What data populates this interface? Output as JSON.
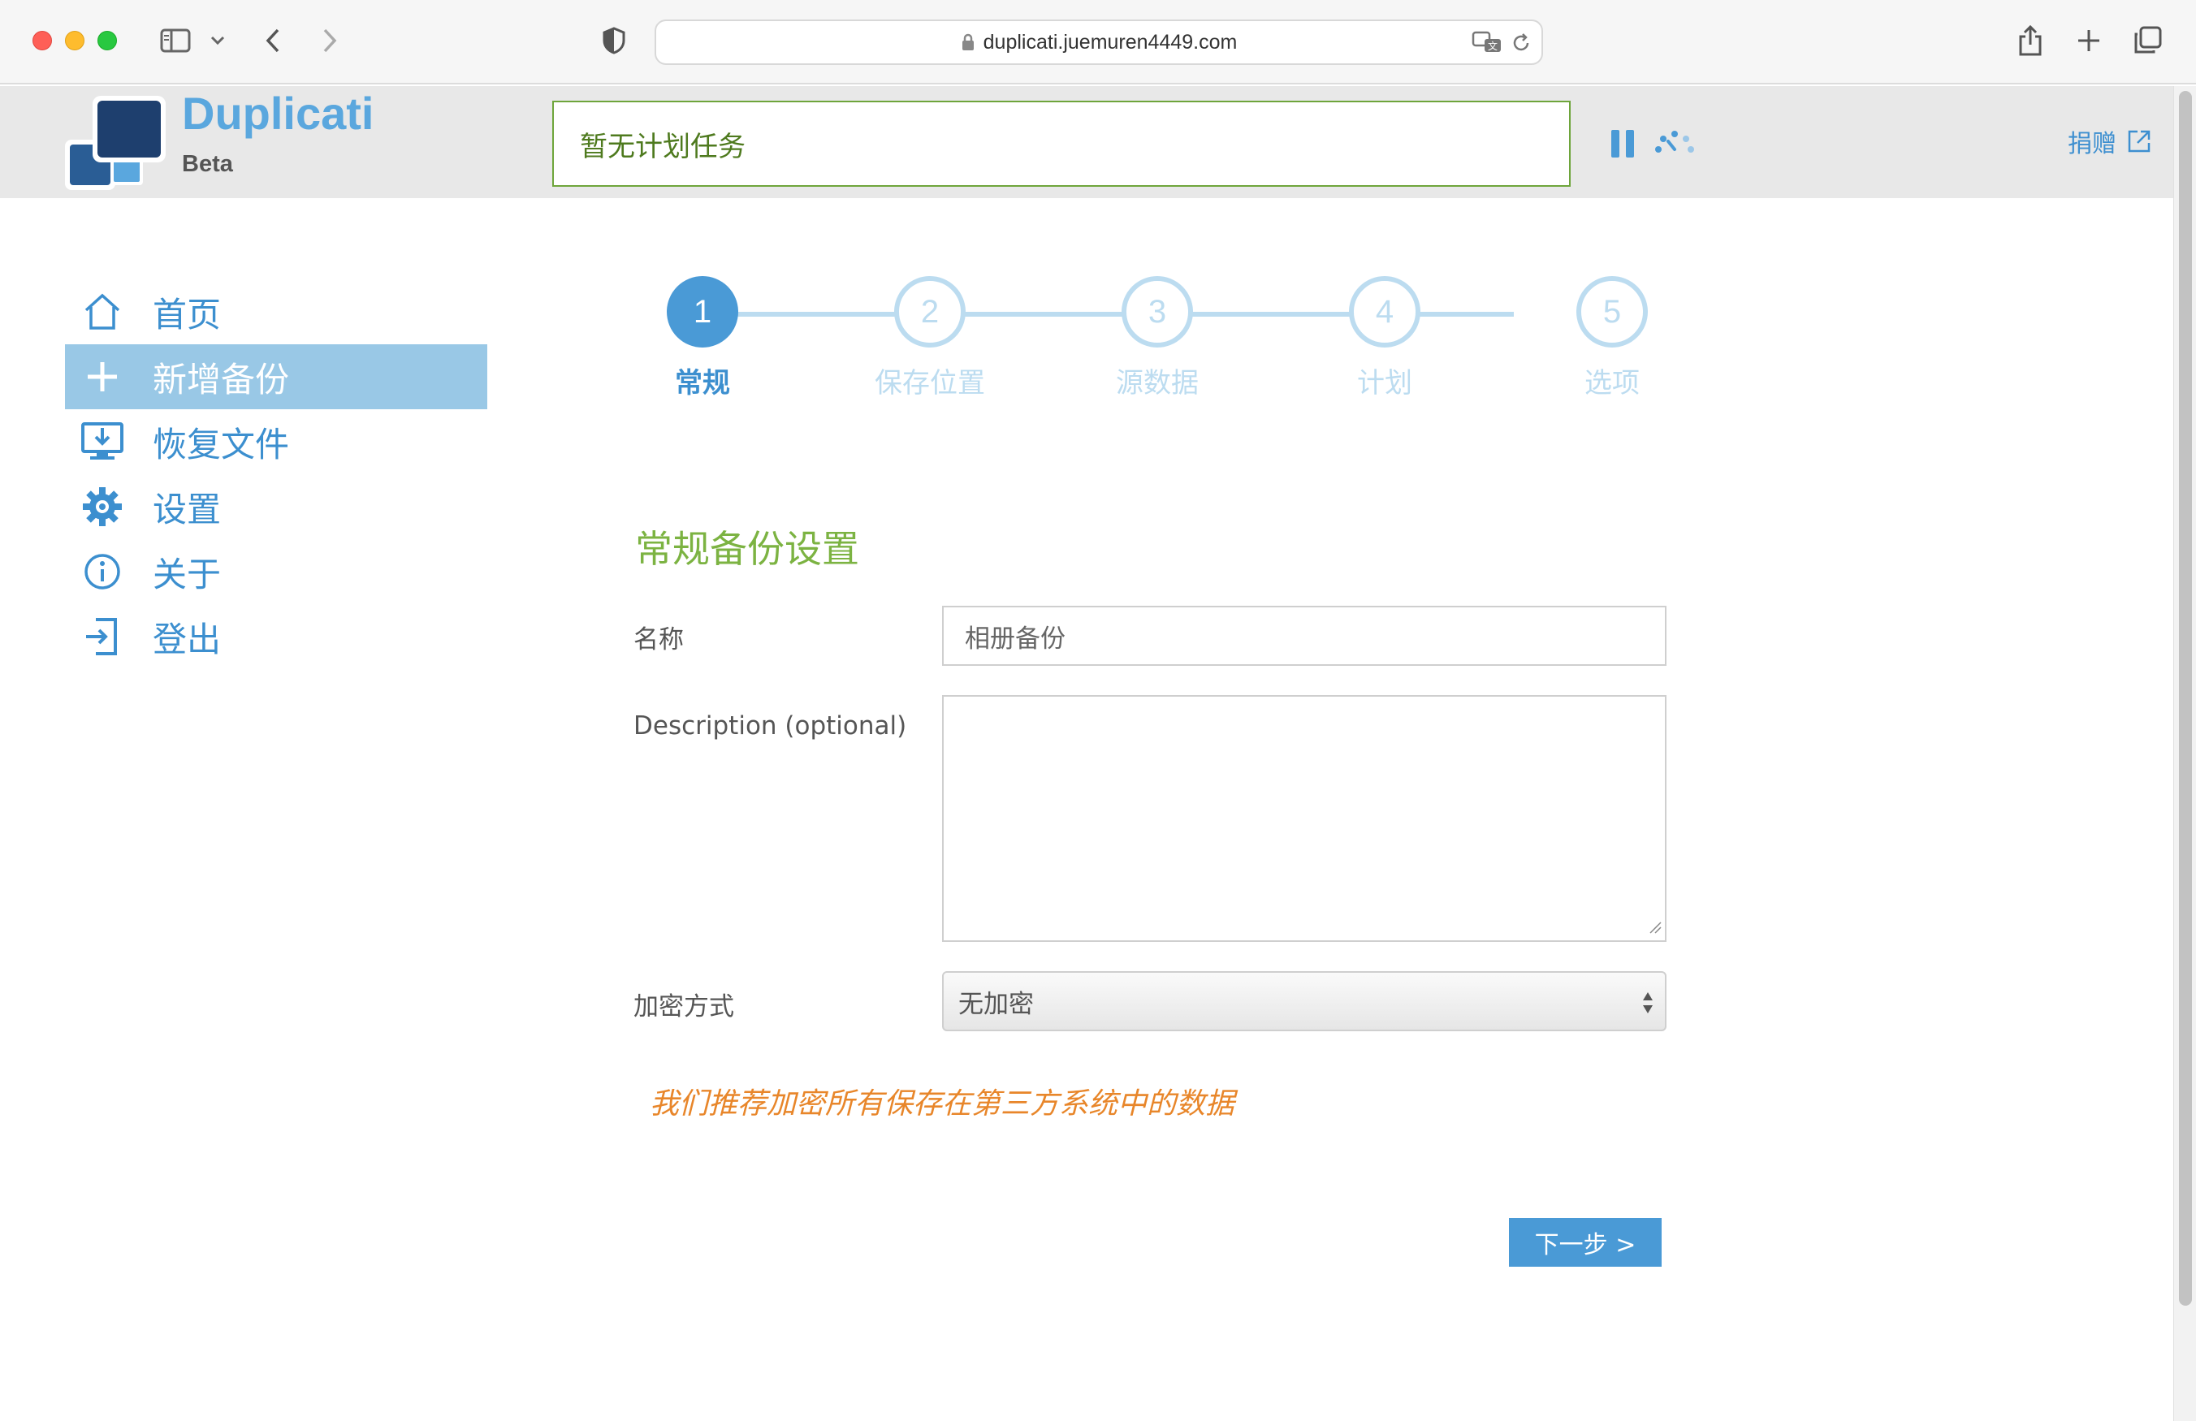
{
  "browser": {
    "url": "duplicati.juemuren4449.com"
  },
  "header": {
    "brand": "Duplicati",
    "brand_sub": "Beta",
    "status": "暂无计划任务",
    "donate": "捐赠"
  },
  "sidebar": {
    "items": [
      {
        "label": "首页",
        "icon": "home-icon",
        "active": false
      },
      {
        "label": "新增备份",
        "icon": "plus-icon",
        "active": true
      },
      {
        "label": "恢复文件",
        "icon": "restore-icon",
        "active": false
      },
      {
        "label": "设置",
        "icon": "gear-icon",
        "active": false
      },
      {
        "label": "关于",
        "icon": "info-icon",
        "active": false
      },
      {
        "label": "登出",
        "icon": "logout-icon",
        "active": false
      }
    ]
  },
  "stepper": {
    "current": 1,
    "steps": [
      {
        "number": "1",
        "label": "常规"
      },
      {
        "number": "2",
        "label": "保存位置"
      },
      {
        "number": "3",
        "label": "源数据"
      },
      {
        "number": "4",
        "label": "计划"
      },
      {
        "number": "5",
        "label": "选项"
      }
    ]
  },
  "form": {
    "title": "常规备份设置",
    "name_label": "名称",
    "name_value": "相册备份",
    "description_label": "Description (optional)",
    "description_value": "",
    "encryption_label": "加密方式",
    "encryption_value": "无加密",
    "warning": "我们推荐加密所有保存在第三方系统中的数据",
    "next_button": "下一步 >"
  },
  "colors": {
    "accent": "#4a9ad6",
    "active_nav": "#99c8e6",
    "title_green": "#7cb342",
    "warning_orange": "#e8862a",
    "status_border": "#6ea53b"
  }
}
